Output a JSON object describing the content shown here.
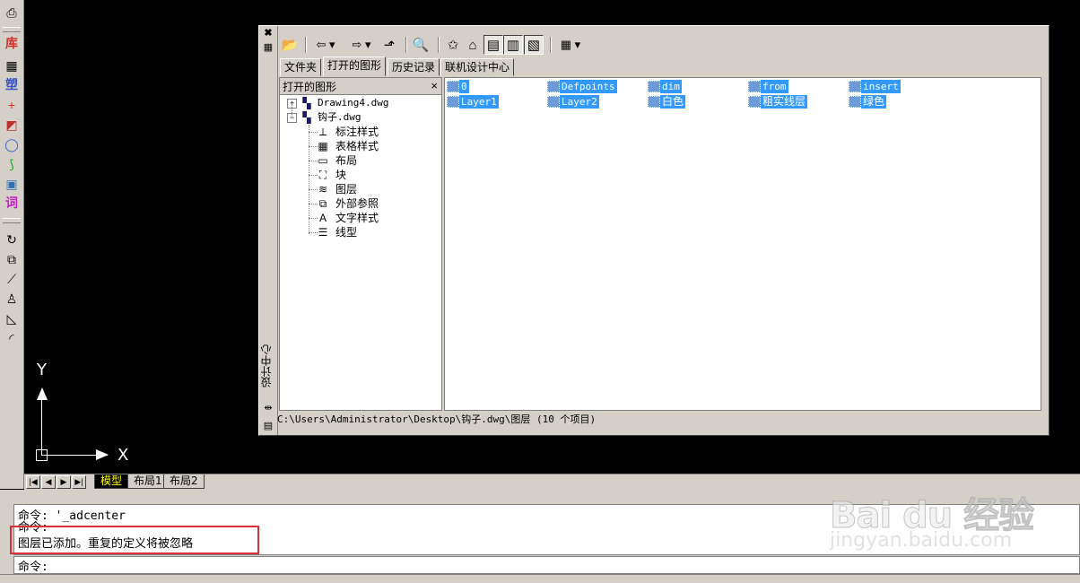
{
  "left_toolbar": {
    "items": [
      {
        "name": "plot-icon",
        "glyph": "⎙"
      },
      {
        "name": "library-icon",
        "glyph": "库",
        "cjk": true,
        "color": "#d4302a"
      },
      {
        "name": "table-icon",
        "glyph": "▦"
      },
      {
        "name": "plastic-icon",
        "glyph": "塑",
        "cjk": true,
        "color": "#3a55c0"
      },
      {
        "name": "cross-icon",
        "glyph": "+",
        "color": "#d4302a"
      },
      {
        "name": "component-icon",
        "glyph": "◩",
        "color": "#c03030"
      },
      {
        "name": "circle-icon",
        "glyph": "◯",
        "color": "#4060d0"
      },
      {
        "name": "curve-icon",
        "glyph": "⟆",
        "color": "#20a030"
      },
      {
        "name": "screen-icon",
        "glyph": "▣",
        "color": "#3070b0"
      },
      {
        "name": "word-icon",
        "glyph": "词",
        "cjk": true,
        "color": "#c020c0"
      },
      {
        "name": "rotate-icon",
        "glyph": "↻"
      },
      {
        "name": "copy-icon",
        "glyph": "⧉"
      },
      {
        "name": "line-icon",
        "glyph": "⟋"
      },
      {
        "name": "stamp-icon",
        "glyph": "♙"
      },
      {
        "name": "chamfer-icon",
        "glyph": "◺"
      },
      {
        "name": "fillet-icon",
        "glyph": "◜"
      }
    ]
  },
  "ucs": {
    "y_label": "Y",
    "x_label": "X"
  },
  "layout_tabs": {
    "nav": [
      "|◀",
      "◀",
      "▶",
      "▶|"
    ],
    "tabs": [
      "模型",
      "布局1",
      "布局2"
    ]
  },
  "design_center": {
    "side_title": "设计中心",
    "toolbar": {
      "buttons": [
        {
          "name": "load-icon",
          "glyph": "📂"
        },
        {
          "name": "back-icon",
          "glyph": "⇦ ▾"
        },
        {
          "name": "forward-icon",
          "glyph": "⇨ ▾"
        },
        {
          "name": "up-icon",
          "glyph": "⬏"
        },
        {
          "name": "search-icon",
          "glyph": "🔍"
        },
        {
          "name": "favorites-icon",
          "glyph": "✩"
        },
        {
          "name": "home-icon",
          "glyph": "⌂"
        },
        {
          "name": "tree-toggle-icon",
          "glyph": "▤"
        },
        {
          "name": "preview-icon",
          "glyph": "▥"
        },
        {
          "name": "description-icon",
          "glyph": "▧"
        },
        {
          "name": "views-icon",
          "glyph": "▦ ▾"
        }
      ]
    },
    "tabs": [
      "文件夹",
      "打开的图形",
      "历史记录",
      "联机设计中心"
    ],
    "tree": {
      "title": "打开的图形",
      "close": "×",
      "drawings": [
        {
          "label": "Drawing4.dwg",
          "expander": "+"
        },
        {
          "label": "钩子.dwg",
          "expander": "−"
        }
      ],
      "children": [
        {
          "label": "标注样式",
          "icon": "dimstyle-icon",
          "glyph": "⟂"
        },
        {
          "label": "表格样式",
          "icon": "tablestyle-icon",
          "glyph": "▦"
        },
        {
          "label": "布局",
          "icon": "layout-icon",
          "glyph": "▭"
        },
        {
          "label": "块",
          "icon": "block-icon",
          "glyph": "⛶"
        },
        {
          "label": "图层",
          "icon": "layer-icon",
          "glyph": "≋"
        },
        {
          "label": "外部参照",
          "icon": "xref-icon",
          "glyph": "⧉"
        },
        {
          "label": "文字样式",
          "icon": "textstyle-icon",
          "glyph": "A"
        },
        {
          "label": "线型",
          "icon": "linetype-icon",
          "glyph": "☰"
        }
      ]
    },
    "layers": [
      {
        "name": "0",
        "cjk": false
      },
      {
        "name": "Defpoints",
        "cjk": false
      },
      {
        "name": "dim",
        "cjk": false
      },
      {
        "name": "from",
        "cjk": false
      },
      {
        "name": "insert",
        "cjk": false
      },
      {
        "name": "Layer1",
        "cjk": false
      },
      {
        "name": "Layer2",
        "cjk": false
      },
      {
        "name": "白色",
        "cjk": true
      },
      {
        "name": "粗实线层",
        "cjk": true
      },
      {
        "name": "绿色",
        "cjk": true
      }
    ],
    "path": "C:\\Users\\Administrator\\Desktop\\钩子.dwg\\图层 (10 个项目)"
  },
  "command": {
    "history": [
      "命令: '_adcenter",
      "命令:",
      "图层已添加。重复的定义将被忽略"
    ],
    "prompt": "命令:"
  },
  "watermark": {
    "brand": "Bai du 经验",
    "url": "jingyan.baidu.com"
  },
  "colors": {
    "selection": "#3399ff",
    "highlight_box": "#d9303a",
    "panel": "#d4d0c8"
  }
}
